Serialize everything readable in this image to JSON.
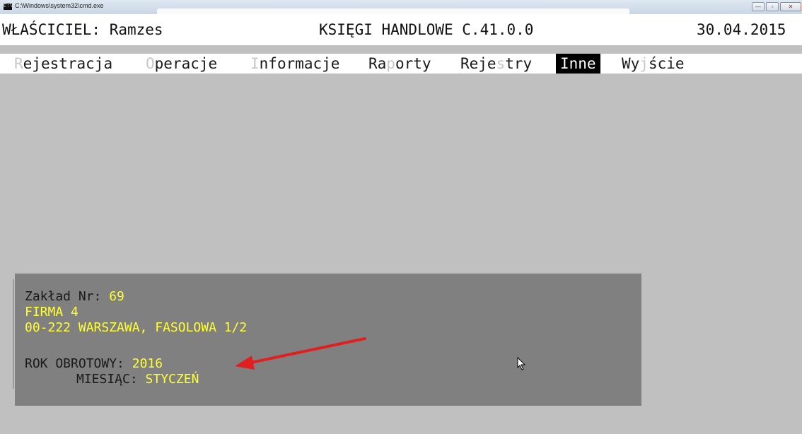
{
  "window": {
    "title": "C:\\Windows\\system32\\cmd.exe",
    "icon": "cmd-icon",
    "buttons": [
      "minimize",
      "maximize",
      "close"
    ]
  },
  "header": {
    "owner": "WŁAŚCICIEL: Ramzes",
    "app": "KSIĘGI HANDLOWE C.41.0.0",
    "date": "30.04.2015"
  },
  "menu": {
    "items": [
      {
        "hot": "R",
        "rest": "ejestracja"
      },
      {
        "hot": "O",
        "rest": "peracje"
      },
      {
        "hot": "I",
        "rest": "nformacje"
      },
      {
        "pre": "Ra",
        "hot": "p",
        "post": "orty"
      },
      {
        "pre": "Reje",
        "hot": "s",
        "post": "try"
      },
      {
        "label": "Inne",
        "active": true
      },
      {
        "pre": "Wy",
        "hot": "j",
        "post": "ście"
      }
    ]
  },
  "panel": {
    "plant_label": "Zakład Nr:",
    "plant_number": "69",
    "company": "FIRMA 4",
    "address": "00-222 WARSZAWA, FASOLOWA 1/2",
    "fiscal_year_label": "ROK OBROTOWY:",
    "fiscal_year": "2016",
    "month_label": "MIESIĄC:",
    "month": "STYCZEŃ"
  },
  "colors": {
    "background": "#c0c0c0",
    "panel": "#808080",
    "value_text": "#ffff33",
    "annotation_arrow": "#e02020"
  }
}
